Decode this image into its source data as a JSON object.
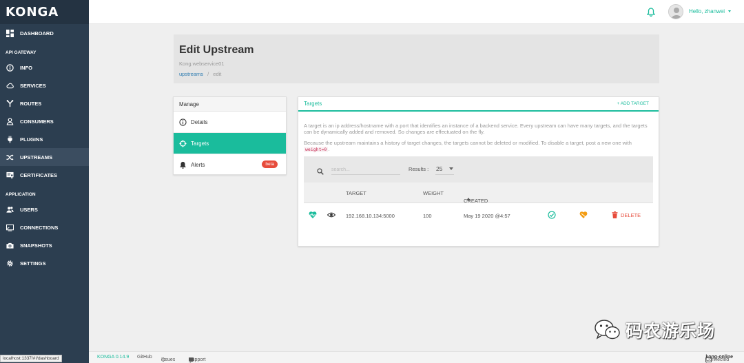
{
  "app": {
    "logo": "KONGA"
  },
  "sidebar": {
    "items": [
      {
        "label": "DASHBOARD",
        "icon": "dashboard-icon"
      },
      {
        "section": "API GATEWAY"
      },
      {
        "label": "INFO",
        "icon": "info-icon"
      },
      {
        "label": "SERVICES",
        "icon": "cloud-icon"
      },
      {
        "label": "ROUTES",
        "icon": "routes-icon"
      },
      {
        "label": "CONSUMERS",
        "icon": "user-icon"
      },
      {
        "label": "PLUGINS",
        "icon": "plug-icon"
      },
      {
        "label": "UPSTREAMS",
        "icon": "shuffle-icon",
        "active": true
      },
      {
        "label": "CERTIFICATES",
        "icon": "certificate-icon"
      },
      {
        "section": "APPLICATION"
      },
      {
        "label": "USERS",
        "icon": "users-icon"
      },
      {
        "label": "CONNECTIONS",
        "icon": "connections-icon"
      },
      {
        "label": "SNAPSHOTS",
        "icon": "camera-icon"
      },
      {
        "label": "SETTINGS",
        "icon": "gear-icon"
      }
    ],
    "status_url": "localhost:1337/#!/dashboard"
  },
  "topbar": {
    "user_label": "Hello, zhanwei"
  },
  "header": {
    "title": "Edit Upstream",
    "subtitle": "Kong.webservice01",
    "breadcrumb_link": "upstreams",
    "breadcrumb_sep": "/",
    "breadcrumb_current": "edit"
  },
  "manage": {
    "title": "Manage",
    "items": [
      {
        "label": "Details",
        "icon": "info-icon"
      },
      {
        "label": "Targets",
        "icon": "crosshair-icon",
        "active": true
      },
      {
        "label": "Alerts",
        "icon": "bell-icon",
        "badge": "beta"
      }
    ]
  },
  "targets": {
    "title": "Targets",
    "add_label": "+ ADD TARGET",
    "desc1": "A target is an ip address/hostname with a port that identifies an instance of a backend service. Every upstream can have many targets, and the targets can be dynamically added and removed. So changes are effectuated on the fly.",
    "desc2_a": "Because the upstream maintains a history of target changes, the targets cannot be deleted or modified. To disable a target, post a new one with",
    "desc2_code": "weight=0",
    "desc2_b": ".",
    "search_placeholder": "search...",
    "results_label": "Results :",
    "results_value": "25",
    "columns": {
      "target": "TARGET",
      "weight": "WEIGHT",
      "created": "CREATED"
    },
    "rows": [
      {
        "target": "192.168.10.134:5000",
        "weight": "100",
        "created": "May 19 2020 @4:57",
        "delete": "DELETE"
      }
    ]
  },
  "footer": {
    "version": "KONGA 0.14.9",
    "github": "GitHub",
    "issues": "Issues",
    "support": "Support the project",
    "connected_prefix": "Connected to",
    "connection": "kong-online"
  },
  "watermark": {
    "text": "码农游乐场"
  },
  "colors": {
    "accent": "#1abc9c",
    "sidebar": "#2c3e50",
    "danger": "#e74c3c",
    "link": "#2a7ab0"
  }
}
